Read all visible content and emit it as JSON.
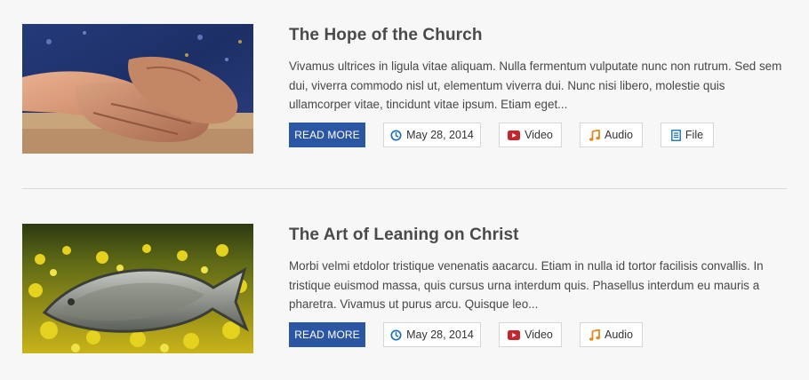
{
  "colors": {
    "read_more_bg": "#2b56a3",
    "clock_icon": "#1b6fb8",
    "video_icon": "#c4262e",
    "audio_icon": "#e08a1e",
    "file_icon": "#1b6fb8"
  },
  "posts": [
    {
      "title": "The Hope of the Church",
      "excerpt": "Vivamus ultrices in ligula vitae aliquam. Nulla fermentum vulputate nunc non rutrum. Sed sem dui, viverra commodo nisl ut, elementum viverra dui. Nunc nisi libero, molestie quis ullamcorper vitae, tincidunt vitae ipsum. Etiam eget...",
      "read_more": "READ MORE",
      "date": "May 28, 2014",
      "video": "Video",
      "audio": "Audio",
      "file": "File",
      "image": "clasped-hands-photo"
    },
    {
      "title": "The Art of Leaning on Christ",
      "excerpt": "Morbi velmi etdolor tristique venenatis aacarcu. Etiam in nulla id tortor facilisis convallis. In tristique euismod massa, quis cursus urna interdum quis. Phasellus interdum eu mauris a pharetra. Vivamus ut purus arcu. Quisque leo...",
      "read_more": "READ MORE",
      "date": "May 28, 2014",
      "video": "Video",
      "audio": "Audio",
      "image": "jesus-fish-emblem-photo"
    }
  ]
}
